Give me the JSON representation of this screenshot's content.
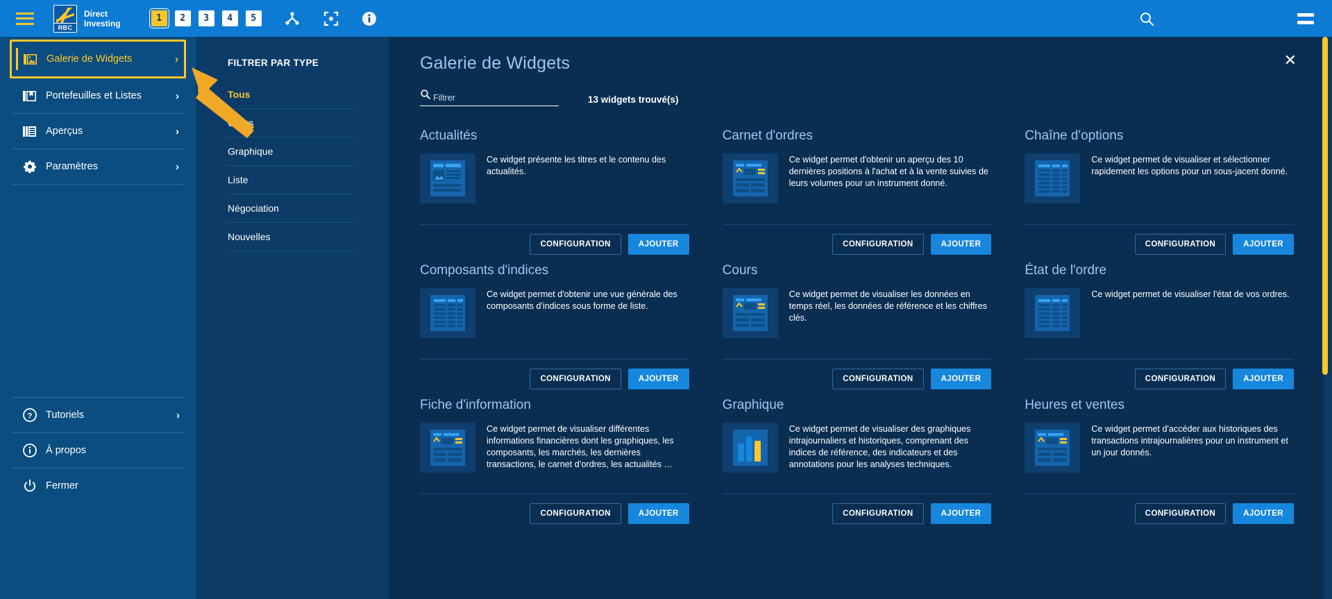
{
  "topbar": {
    "menu_icon": "hamburger-icon",
    "logo_text": "RBC",
    "brand_line1": "Direct",
    "brand_line2": "Investing",
    "workspaces": [
      "1",
      "2",
      "3",
      "4",
      "5"
    ],
    "active_workspace": "1",
    "link_icon": "share-node-icon",
    "focus_icon": "focus-target-icon",
    "info_icon": "info-circle-icon",
    "search_icon": "search-icon",
    "menu_right_icon": "equals-menu-icon"
  },
  "sidebar": {
    "items": [
      {
        "label": "Galerie de Widgets",
        "icon": "image-gallery-icon",
        "chevron": "›",
        "selected": true
      },
      {
        "label": "Portefeuilles et Listes",
        "icon": "portfolio-icon",
        "chevron": "›",
        "selected": false
      },
      {
        "label": "Aperçus",
        "icon": "overview-icon",
        "chevron": "›",
        "selected": false
      },
      {
        "label": "Paramètres",
        "icon": "gear-icon",
        "chevron": "›",
        "selected": false
      }
    ],
    "bottom_items": [
      {
        "label": "Tutoriels",
        "icon": "question-circle-icon",
        "chevron": "›"
      },
      {
        "label": "À propos",
        "icon": "info-circle-icon",
        "chevron": ""
      },
      {
        "label": "Fermer",
        "icon": "power-icon",
        "chevron": ""
      }
    ]
  },
  "filter": {
    "title": "FILTRER PAR TYPE",
    "items": [
      {
        "label": "Tous",
        "active": true
      },
      {
        "label": "Cours",
        "active": false
      },
      {
        "label": "Graphique",
        "active": false
      },
      {
        "label": "Liste",
        "active": false
      },
      {
        "label": "Négociation",
        "active": false
      },
      {
        "label": "Nouvelles",
        "active": false
      }
    ]
  },
  "main": {
    "title": "Galerie de Widgets",
    "close_icon": "close-icon",
    "search_placeholder": "Filtrer",
    "search_value": "",
    "search_icon": "search-icon",
    "results_count": "13 widgets trouvé(s)",
    "button_config": "CONFIGURATION",
    "button_add": "AJOUTER",
    "cards": [
      {
        "title": "Actualités",
        "description": "Ce widget présente les titres et le contenu des actualités.",
        "thumb": "news-article-thumb"
      },
      {
        "title": "Carnet d'ordres",
        "description": "Ce widget permet d'obtenir un aperçu des 10 dernières positions à l'achat et à la vente suivies de leurs volumes pour un instrument donné.",
        "thumb": "quote-panel-thumb"
      },
      {
        "title": "Chaîne d'options",
        "description": "Ce widget permet de visualiser et sélectionner rapidement les options pour un sous-jacent donné.",
        "thumb": "table-grid-thumb"
      },
      {
        "title": "Composants d'indices",
        "description": "Ce widget permet d'obtenir une vue générale des composants d'indices sous forme de liste.",
        "thumb": "table-grid-thumb"
      },
      {
        "title": "Cours",
        "description": "Ce widget permet de visualiser les données en temps réel, les données de référence et les chiffres clés.",
        "thumb": "quote-panel-thumb"
      },
      {
        "title": "État de l'ordre",
        "description": "Ce widget permet de visualiser l'état de vos ordres.",
        "thumb": "table-grid-thumb"
      },
      {
        "title": "Fiche d'information",
        "description": "Ce widget permet de visualiser différentes informations financières dont les graphiques, les composants, les marchés, les dernières transactions, le carnet d’ordres, les actualités …",
        "thumb": "quote-panel-thumb"
      },
      {
        "title": "Graphique",
        "description": "Ce widget permet de visualiser des graphiques intrajournaliers et historiques, comprenant des indices de référence, des indicateurs et des annotations pour les analyses techniques.",
        "thumb": "bar-chart-thumb"
      },
      {
        "title": "Heures et ventes",
        "description": "Ce widget permet d'accéder aux historiques des transactions intrajournalières pour un instrument et un jour donnés.",
        "thumb": "quote-panel-thumb"
      }
    ]
  },
  "colors": {
    "topbar_blue": "#0d7bd4",
    "sidebar_blue": "#0b4d80",
    "filter_blue": "#0b3b66",
    "main_bg": "#0a2e52",
    "accent_yellow": "#ffc629",
    "button_blue": "#1787dd",
    "title_text": "#9dc7ee"
  },
  "annotation": {
    "arrow_icon": "pointer-arrow-annotation",
    "arrow_color": "#f0a927"
  }
}
